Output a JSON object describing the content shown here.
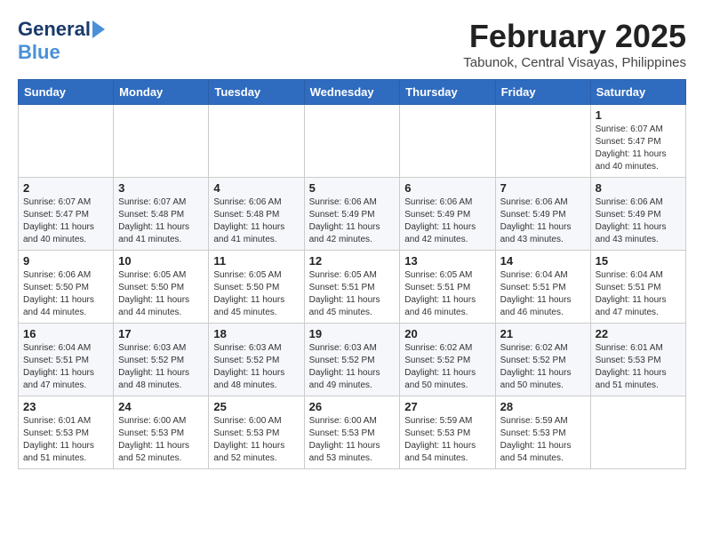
{
  "logo": {
    "line1": "General",
    "line2": "Blue"
  },
  "title": "February 2025",
  "location": "Tabunok, Central Visayas, Philippines",
  "days_of_week": [
    "Sunday",
    "Monday",
    "Tuesday",
    "Wednesday",
    "Thursday",
    "Friday",
    "Saturday"
  ],
  "weeks": [
    [
      {
        "day": "",
        "info": ""
      },
      {
        "day": "",
        "info": ""
      },
      {
        "day": "",
        "info": ""
      },
      {
        "day": "",
        "info": ""
      },
      {
        "day": "",
        "info": ""
      },
      {
        "day": "",
        "info": ""
      },
      {
        "day": "1",
        "info": "Sunrise: 6:07 AM\nSunset: 5:47 PM\nDaylight: 11 hours\nand 40 minutes."
      }
    ],
    [
      {
        "day": "2",
        "info": "Sunrise: 6:07 AM\nSunset: 5:47 PM\nDaylight: 11 hours\nand 40 minutes."
      },
      {
        "day": "3",
        "info": "Sunrise: 6:07 AM\nSunset: 5:48 PM\nDaylight: 11 hours\nand 41 minutes."
      },
      {
        "day": "4",
        "info": "Sunrise: 6:06 AM\nSunset: 5:48 PM\nDaylight: 11 hours\nand 41 minutes."
      },
      {
        "day": "5",
        "info": "Sunrise: 6:06 AM\nSunset: 5:49 PM\nDaylight: 11 hours\nand 42 minutes."
      },
      {
        "day": "6",
        "info": "Sunrise: 6:06 AM\nSunset: 5:49 PM\nDaylight: 11 hours\nand 42 minutes."
      },
      {
        "day": "7",
        "info": "Sunrise: 6:06 AM\nSunset: 5:49 PM\nDaylight: 11 hours\nand 43 minutes."
      },
      {
        "day": "8",
        "info": "Sunrise: 6:06 AM\nSunset: 5:49 PM\nDaylight: 11 hours\nand 43 minutes."
      }
    ],
    [
      {
        "day": "9",
        "info": "Sunrise: 6:06 AM\nSunset: 5:50 PM\nDaylight: 11 hours\nand 44 minutes."
      },
      {
        "day": "10",
        "info": "Sunrise: 6:05 AM\nSunset: 5:50 PM\nDaylight: 11 hours\nand 44 minutes."
      },
      {
        "day": "11",
        "info": "Sunrise: 6:05 AM\nSunset: 5:50 PM\nDaylight: 11 hours\nand 45 minutes."
      },
      {
        "day": "12",
        "info": "Sunrise: 6:05 AM\nSunset: 5:51 PM\nDaylight: 11 hours\nand 45 minutes."
      },
      {
        "day": "13",
        "info": "Sunrise: 6:05 AM\nSunset: 5:51 PM\nDaylight: 11 hours\nand 46 minutes."
      },
      {
        "day": "14",
        "info": "Sunrise: 6:04 AM\nSunset: 5:51 PM\nDaylight: 11 hours\nand 46 minutes."
      },
      {
        "day": "15",
        "info": "Sunrise: 6:04 AM\nSunset: 5:51 PM\nDaylight: 11 hours\nand 47 minutes."
      }
    ],
    [
      {
        "day": "16",
        "info": "Sunrise: 6:04 AM\nSunset: 5:51 PM\nDaylight: 11 hours\nand 47 minutes."
      },
      {
        "day": "17",
        "info": "Sunrise: 6:03 AM\nSunset: 5:52 PM\nDaylight: 11 hours\nand 48 minutes."
      },
      {
        "day": "18",
        "info": "Sunrise: 6:03 AM\nSunset: 5:52 PM\nDaylight: 11 hours\nand 48 minutes."
      },
      {
        "day": "19",
        "info": "Sunrise: 6:03 AM\nSunset: 5:52 PM\nDaylight: 11 hours\nand 49 minutes."
      },
      {
        "day": "20",
        "info": "Sunrise: 6:02 AM\nSunset: 5:52 PM\nDaylight: 11 hours\nand 50 minutes."
      },
      {
        "day": "21",
        "info": "Sunrise: 6:02 AM\nSunset: 5:52 PM\nDaylight: 11 hours\nand 50 minutes."
      },
      {
        "day": "22",
        "info": "Sunrise: 6:01 AM\nSunset: 5:53 PM\nDaylight: 11 hours\nand 51 minutes."
      }
    ],
    [
      {
        "day": "23",
        "info": "Sunrise: 6:01 AM\nSunset: 5:53 PM\nDaylight: 11 hours\nand 51 minutes."
      },
      {
        "day": "24",
        "info": "Sunrise: 6:00 AM\nSunset: 5:53 PM\nDaylight: 11 hours\nand 52 minutes."
      },
      {
        "day": "25",
        "info": "Sunrise: 6:00 AM\nSunset: 5:53 PM\nDaylight: 11 hours\nand 52 minutes."
      },
      {
        "day": "26",
        "info": "Sunrise: 6:00 AM\nSunset: 5:53 PM\nDaylight: 11 hours\nand 53 minutes."
      },
      {
        "day": "27",
        "info": "Sunrise: 5:59 AM\nSunset: 5:53 PM\nDaylight: 11 hours\nand 54 minutes."
      },
      {
        "day": "28",
        "info": "Sunrise: 5:59 AM\nSunset: 5:53 PM\nDaylight: 11 hours\nand 54 minutes."
      },
      {
        "day": "",
        "info": ""
      }
    ]
  ]
}
